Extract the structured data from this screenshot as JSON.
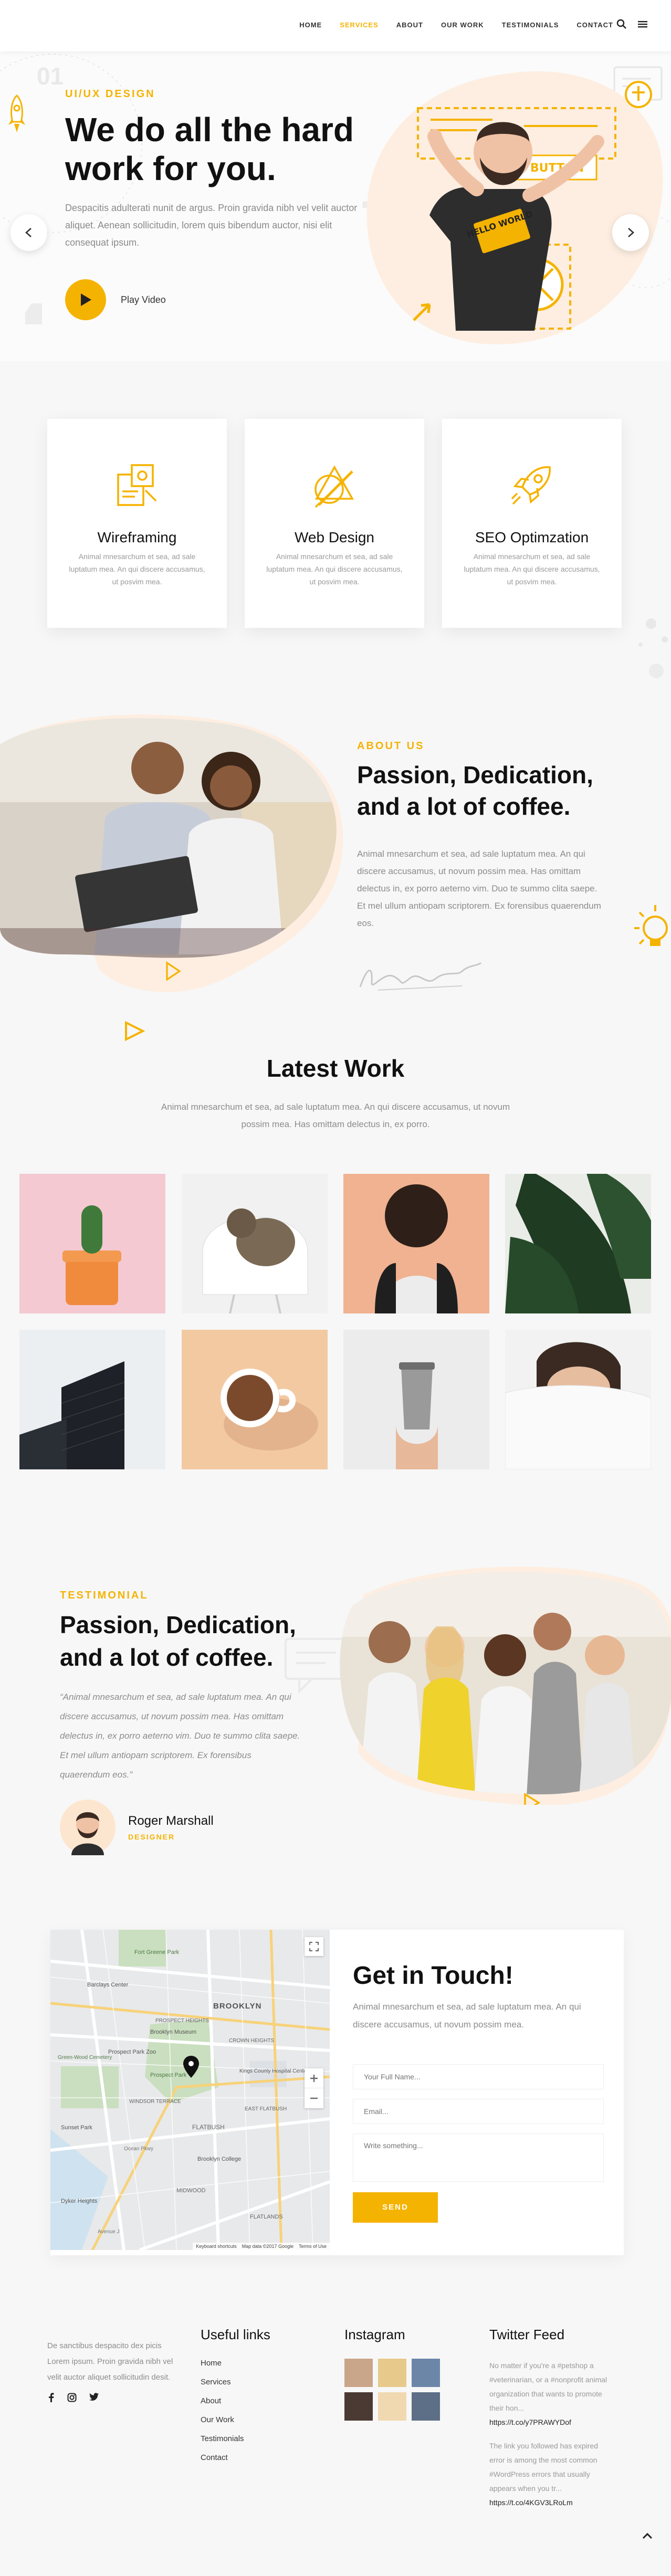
{
  "nav": {
    "items": [
      "HOME",
      "SERVICES",
      "ABOUT",
      "OUR WORK",
      "TESTIMONIALS",
      "CONTACT"
    ],
    "active_index": 1,
    "icons": [
      "search-icon",
      "menu-icon"
    ]
  },
  "hero": {
    "deco_number": "01",
    "kicker": "UI/UX DESIGN",
    "title": "We do all the hard work for you.",
    "lead": "Despacitis adulterati nunit de argus. Proin gravida nibh vel velit auctor aliquet. Aenean sollicitudin, lorem quis bibendum auctor, nisi elit consequat ipsum.",
    "play_label": "Play Video",
    "art_badge_1": "BUTTON",
    "art_shirt": "HELLO WORLD"
  },
  "services": [
    {
      "title": "Wireframing",
      "icon": "wireframe-icon",
      "text": "Animal mnesarchum et sea, ad sale luptatum mea. An qui discere accusamus, ut posvim mea."
    },
    {
      "title": "Web Design",
      "icon": "design-tools-icon",
      "text": "Animal mnesarchum et sea, ad sale luptatum mea. An qui discere accusamus, ut posvim mea."
    },
    {
      "title": "SEO Optimzation",
      "icon": "rocket-icon",
      "text": "Animal mnesarchum et sea, ad sale luptatum mea. An qui discere accusamus, ut posvim mea."
    }
  ],
  "about": {
    "kicker": "ABOUT US",
    "title": "Passion, Dedication, and a lot of coffee.",
    "text": "Animal mnesarchum et sea, ad sale luptatum mea. An qui discere accusamus, ut novum possim mea. Has omittam delectus in, ex porro aeterno vim. Duo te summo clita saepe. Et mel ullum antiopam scriptorem. Ex forensibus quaerendum eos."
  },
  "work": {
    "title": "Latest Work",
    "text": "Animal mnesarchum et sea, ad sale luptatum mea. An qui discere accusamus, ut novum possim mea. Has omittam delectus in, ex porro."
  },
  "testimonial": {
    "kicker": "TESTIMONIAL",
    "title": "Passion, Dedication, and a lot of coffee.",
    "quote": "“Animal mnesarchum et sea, ad sale luptatum mea. An qui discere accusamus, ut novum possim mea. Has omittam delectus in, ex porro aeterno vim. Duo te summo clita saepe. Et mel ullum antiopam scriptorem. Ex forensibus quaerendum eos.”",
    "name": "Roger Marshall",
    "role": "DESIGNER"
  },
  "contact": {
    "title": "Get in Touch!",
    "text": "Animal mnesarchum et sea, ad sale luptatum mea. An qui discere accusamus, ut novum possim mea.",
    "name_placeholder": "Your Full Name...",
    "email_placeholder": "Email...",
    "message_placeholder": "Write something...",
    "send_label": "SEND",
    "map_labels": [
      "Fort Greene Park",
      "Barclays Center",
      "BROOKLYN",
      "PROSPECT HEIGHTS",
      "Brooklyn Museum",
      "CROWN HEIGHTS",
      "Prospect Park Zoo",
      "Prospect Park",
      "Green-Wood Cemetery",
      "Kings County Hospital Center",
      "EAST FLATBUSH",
      "FLATBUSH",
      "Brooklyn College",
      "Sunset Park",
      "Dyker Heights",
      "MIDWOOD",
      "FLATLANDS",
      "WINDSOR TERRACE",
      "Ocean Pkwy",
      "Avenue J"
    ],
    "map_footer": [
      "Keyboard shortcuts",
      "Map data ©2017 Google",
      "Terms of Use"
    ]
  },
  "footer": {
    "about": "De sanctibus despacito dex picis Lorem ipsum. Proin gravida nibh vel velit auctor aliquet sollicitudin desit.",
    "social": [
      "facebook-icon",
      "instagram-icon",
      "twitter-icon"
    ],
    "useful_title": "Useful links",
    "useful_links": [
      "Home",
      "Services",
      "About",
      "Our Work",
      "Testimonials",
      "Contact"
    ],
    "insta_title": "Instagram",
    "twitter_title": "Twitter Feed",
    "tweet1": "No matter if you're a #petshop a #veterinarian, or a #nonprofit animal organization that wants to promote their hon...",
    "tweet1_link": "https://t.co/y7PRAWYDof",
    "tweet2": "The link you followed has expired error is among the most common #WordPress errors that usually appears when you tr...",
    "tweet2_link": "https://t.co/4KGV3LRoLm"
  }
}
